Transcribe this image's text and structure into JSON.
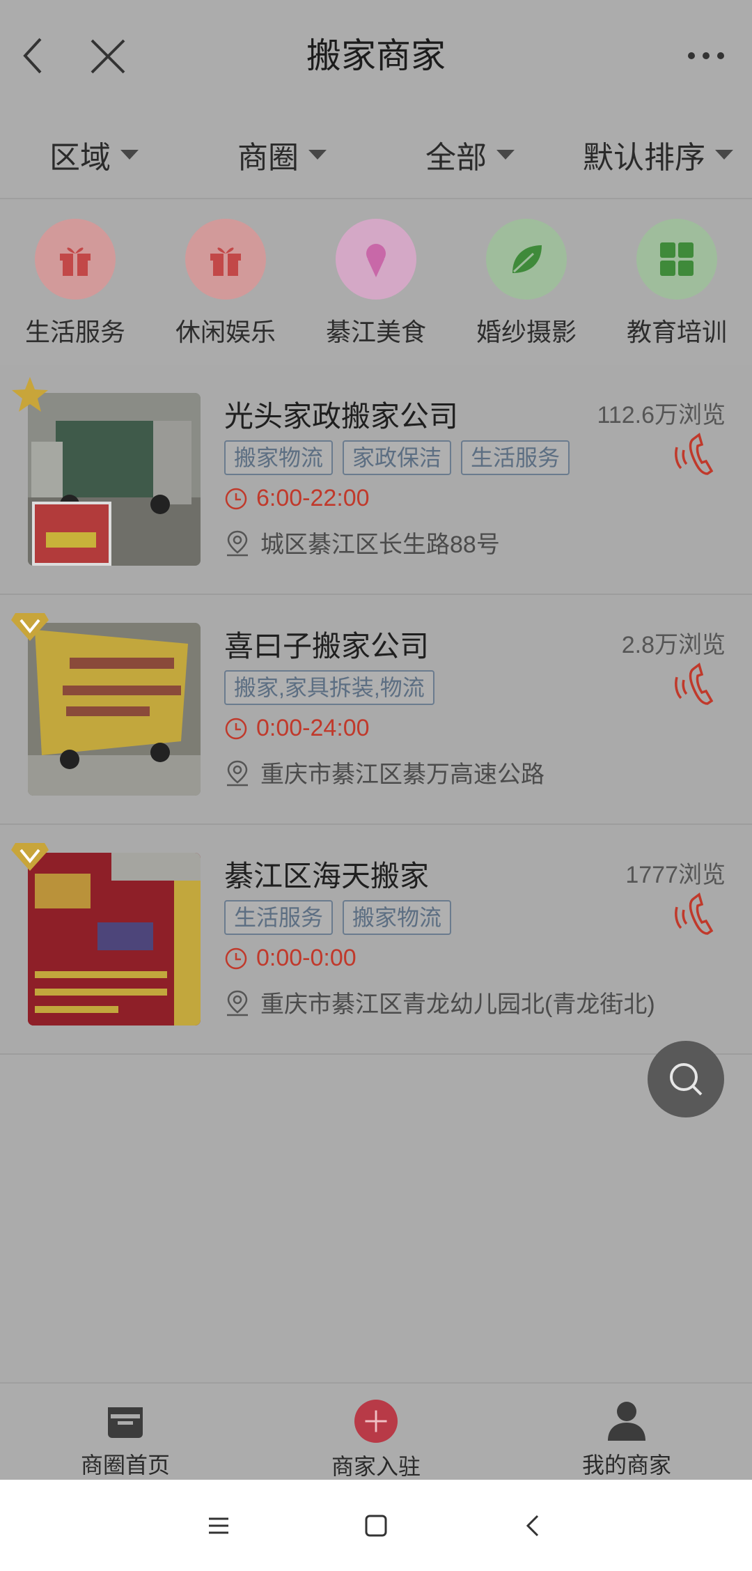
{
  "header": {
    "title": "搬家商家"
  },
  "filters": [
    {
      "label": "区域"
    },
    {
      "label": "商圈"
    },
    {
      "label": "全部"
    },
    {
      "label": "默认排序"
    }
  ],
  "categories": [
    {
      "label": "生活服务",
      "icon": "gift-icon",
      "color": "#c24848"
    },
    {
      "label": "休闲娱乐",
      "icon": "gift-icon",
      "color": "#c24848"
    },
    {
      "label": "綦江美食",
      "icon": "ice-cream-icon",
      "color": "#c868a8"
    },
    {
      "label": "婚纱摄影",
      "icon": "leaf-icon",
      "color": "#3f8a3a"
    },
    {
      "label": "教育培训",
      "icon": "grid-icon",
      "color": "#3f8a3a"
    }
  ],
  "listings": [
    {
      "name": "光头家政搬家公司",
      "views": "112.6万浏览",
      "tags": [
        "搬家物流",
        "家政保洁",
        "生活服务"
      ],
      "hours": "6:00-22:00",
      "address": "城区綦江区长生路88号",
      "badge": "star"
    },
    {
      "name": "喜曰子搬家公司",
      "views": "2.8万浏览",
      "tags": [
        "搬家,家具拆装,物流"
      ],
      "hours": "0:00-24:00",
      "address": "重庆市綦江区綦万高速公路",
      "badge": "vip"
    },
    {
      "name": "綦江区海天搬家",
      "views": "1777浏览",
      "tags": [
        "生活服务",
        "搬家物流"
      ],
      "hours": "0:00-0:00",
      "address": "重庆市綦江区青龙幼儿园北(青龙街北)",
      "badge": "vip"
    }
  ],
  "nav": [
    {
      "label": "商圈首页"
    },
    {
      "label": "商家入驻"
    },
    {
      "label": "我的商家"
    }
  ],
  "colors": {
    "accent": "#c0392b",
    "tag": "#5c6e82"
  }
}
